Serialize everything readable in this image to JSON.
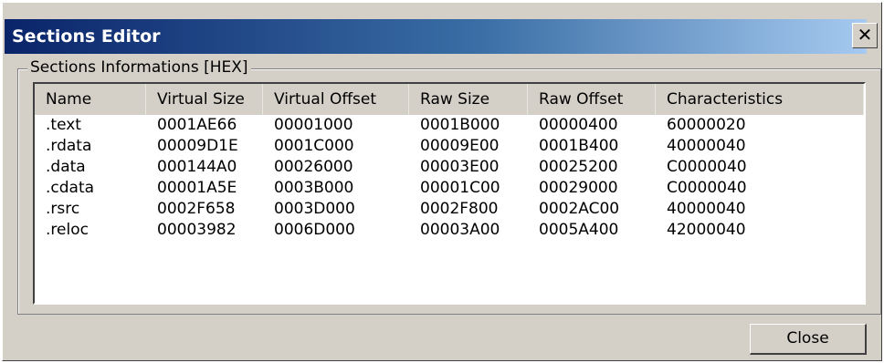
{
  "window": {
    "title": "Sections Editor",
    "close_glyph": "✕"
  },
  "group": {
    "legend": "Sections Informations [HEX]"
  },
  "table": {
    "columns": [
      "Name",
      "Virtual Size",
      "Virtual Offset",
      "Raw Size",
      "Raw Offset",
      "Characteristics"
    ],
    "rows": [
      [
        ".text",
        "0001AE66",
        "00001000",
        "0001B000",
        "00000400",
        "60000020"
      ],
      [
        ".rdata",
        "00009D1E",
        "0001C000",
        "00009E00",
        "0001B400",
        "40000040"
      ],
      [
        ".data",
        "000144A0",
        "00026000",
        "00003E00",
        "00025200",
        "C0000040"
      ],
      [
        ".cdata",
        "00001A5E",
        "0003B000",
        "00001C00",
        "00029000",
        "C0000040"
      ],
      [
        ".rsrc",
        "0002F658",
        "0003D000",
        "0002F800",
        "0002AC00",
        "40000040"
      ],
      [
        ".reloc",
        "00003982",
        "0006D000",
        "00003A00",
        "0005A400",
        "42000040"
      ]
    ]
  },
  "buttons": {
    "close_label": "Close"
  },
  "colors": {
    "title_gradient_start": "#0a246a",
    "title_gradient_end": "#a6caf0",
    "dialog_face": "#d4d0c8"
  }
}
